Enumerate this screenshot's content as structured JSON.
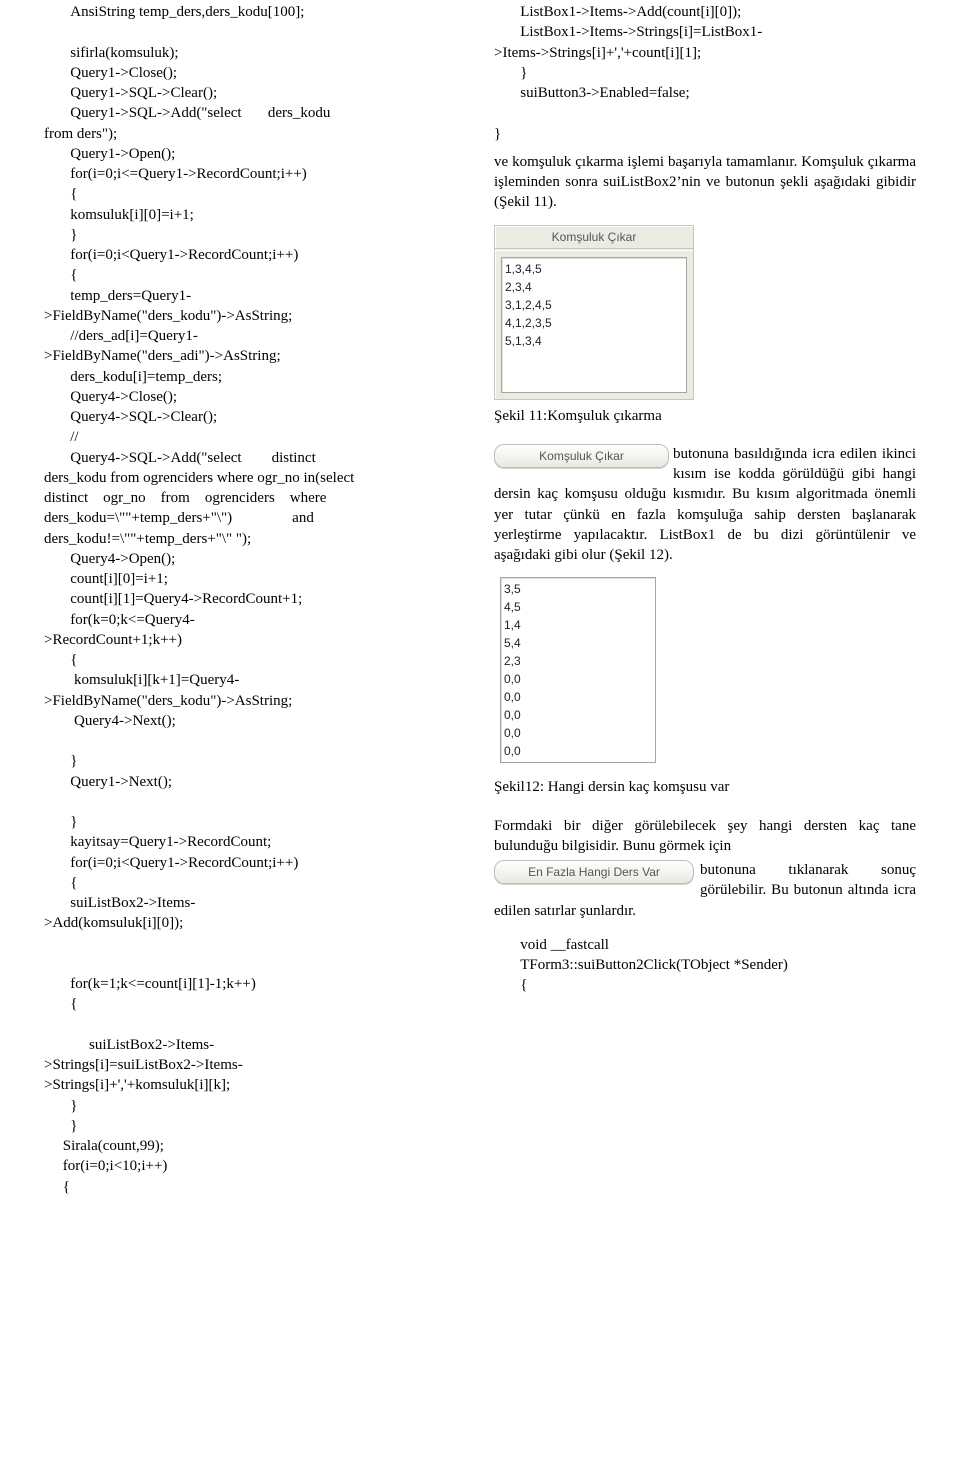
{
  "col1": {
    "code1": "       AnsiString temp_ders,ders_kodu[100];\n\n       sifirla(komsuluk);\n       Query1->Close();\n       Query1->SQL->Clear();\n       Query1->SQL->Add(\"select       ders_kodu\nfrom ders\");\n       Query1->Open();\n       for(i=0;i<=Query1->RecordCount;i++)\n       {\n       komsuluk[i][0]=i+1;\n       }\n       for(i=0;i<Query1->RecordCount;i++)\n       {\n       temp_ders=Query1-\n>FieldByName(\"ders_kodu\")->AsString;\n       //ders_ad[i]=Query1-\n>FieldByName(\"ders_adi\")->AsString;\n       ders_kodu[i]=temp_ders;\n       Query4->Close();\n       Query4->SQL->Clear();\n       //\n       Query4->SQL->Add(\"select        distinct\nders_kodu from ogrenciders where ogr_no in(select\ndistinct    ogr_no    from    ogrenciders    where\nders_kodu=\\\"\"+temp_ders+\"\\\")                and\nders_kodu!=\\\"\"+temp_ders+\"\\\" \");\n       Query4->Open();\n       count[i][0]=i+1;\n       count[i][1]=Query4->RecordCount+1;\n       for(k=0;k<=Query4-\n>RecordCount+1;k++)\n       {\n        komsuluk[i][k+1]=Query4-\n>FieldByName(\"ders_kodu\")->AsString;\n        Query4->Next();\n\n       }\n       Query1->Next();\n\n       }\n       kayitsay=Query1->RecordCount;\n       for(i=0;i<Query1->RecordCount;i++)\n       {\n       suiListBox2->Items-\n>Add(komsuluk[i][0]);\n\n\n       for(k=1;k<=count[i][1]-1;k++)\n       {\n\n            suiListBox2->Items-\n>Strings[i]=suiListBox2->Items-\n>Strings[i]+','+komsuluk[i][k];\n       }\n       }\n     Sirala(count,99);\n     for(i=0;i<10;i++)\n     {"
  },
  "col2": {
    "code1": "       ListBox1->Items->Add(count[i][0]);\n       ListBox1->Items->Strings[i]=ListBox1-\n>Items->Strings[i]+','+count[i][1];\n       }\n       suiButton3->Enabled=false;\n\n}",
    "para1": "ve komşuluk çıkarma işlemi başarıyla tamamlanır. Komşuluk çıkarma işleminden sonra  suiListBox2’nin ve butonun şekli aşağıdaki gibidir (Şekil 11).",
    "panel1": {
      "title": "Komşuluk Çıkar",
      "list": "1,3,4,5\n2,3,4\n3,1,2,4,5\n4,1,2,3,5\n5,1,3,4"
    },
    "cap1": "Şekil 11:Komşuluk çıkarma",
    "btn1": "Komşuluk Çıkar",
    "para2_lead": " butonuna basıldığında icra edilen ikinci kısım ise kodda görüldüğü gibi hangi dersin kaç komşusu olduğu kısmıdır. Bu kısım algoritmada önemli yer tutar çünkü en fazla komşuluğa sahip dersten başlanarak yerleştirme yapılacaktır. ListBox1 de bu dizi görüntülenir ve aşağıdaki gibi olur (Şekil 12).",
    "list2": "3,5\n4,5\n1,4\n5,4\n2,3\n0,0\n0,0\n0,0\n0,0\n0,0",
    "cap2": "Şekil12: Hangi dersin kaç komşusu var",
    "para3_pre": "Formdaki bir diğer görülebilecek şey hangi dersten kaç tane bulunduğu bilgisidir. Bunu görmek için",
    "btn2": "En Fazla Hangi Ders Var",
    "para3_post": " butonuna tıklanarak sonuç görülebilir. Bu butonun altında icra edilen satırlar şunlardır.",
    "code2": "       void __fastcall\n       TForm3::suiButton2Click(TObject *Sender)\n       {"
  }
}
